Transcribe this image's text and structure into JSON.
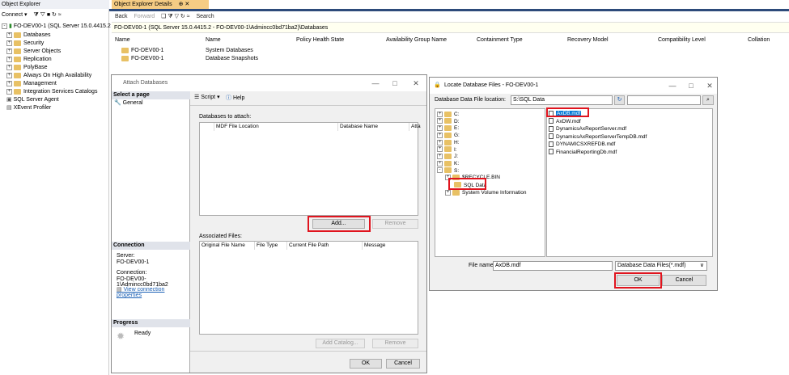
{
  "object_explorer": {
    "title": "Object Explorer",
    "connect_label": "Connect ▾",
    "server": "FO-DEV00-1 (SQL Server 15.0.4415.2 - F",
    "items": [
      "Databases",
      "Security",
      "Server Objects",
      "Replication",
      "PolyBase",
      "Always On High Availability",
      "Management",
      "Integration Services Catalogs",
      "SQL Server Agent",
      "XEvent Profiler"
    ]
  },
  "details": {
    "tab_label": "Object Explorer Details",
    "back": "Back",
    "forward": "Forward",
    "search": "Search",
    "path": "FO-DEV00-1 (SQL Server 15.0.4415.2 - FO-DEV00-1\\Admincc0bd71ba2)\\Databases",
    "columns": [
      "Name",
      "Name",
      "Policy Health State",
      "Availability Group Name",
      "Containment Type",
      "Recovery Model",
      "Compatibility Level",
      "Collation"
    ],
    "rows": [
      {
        "server": "FO-DEV00-1",
        "name": "System Databases"
      },
      {
        "server": "FO-DEV00-1",
        "name": "Database Snapshots"
      }
    ]
  },
  "attach": {
    "title": "Attach Databases",
    "select_page": "Select a page",
    "general": "General",
    "script": "Script",
    "help": "Help",
    "databases_label": "Databases to attach:",
    "db_columns": [
      "MDF File Location",
      "Database Name",
      "Atta"
    ],
    "add": "Add...",
    "remove": "Remove",
    "assoc_label": "Associated Files:",
    "assoc_columns": [
      "Original File Name",
      "File Type",
      "Current File Path",
      "Message"
    ],
    "add_catalog": "Add Catalog...",
    "remove2": "Remove",
    "ok": "OK",
    "cancel": "Cancel",
    "connection_h": "Connection",
    "server_label": "Server:",
    "server_value": "FO-DEV00-1",
    "connection_label": "Connection:",
    "connection_value": "FO-DEV00-1\\Admincc0bd71ba2",
    "view_props": "View connection properties",
    "progress_h": "Progress",
    "ready": "Ready"
  },
  "locate": {
    "title": "Locate Database Files - FO-DEV00-1",
    "location_label": "Database Data File location:",
    "location_value": "S:\\SQL Data",
    "drives": [
      "C:",
      "D:",
      "E:",
      "G:",
      "H:",
      "I:",
      "J:",
      "K:",
      "S:"
    ],
    "s_children": [
      "$RECYCLE.BIN",
      "SQL Data",
      "System Volume Information"
    ],
    "files": [
      "AxDB.mdf",
      "AxDW.mdf",
      "DynamicsAxReportServer.mdf",
      "DynamicsAxReportServerTempDB.mdf",
      "DYNAMICSXREFDB.mdf",
      "FinancialReportingDb.mdf"
    ],
    "file_name_label": "File name:",
    "file_name_value": "AxDB.mdf",
    "file_type": "Database Data Files(*.mdf)",
    "ok": "OK",
    "cancel": "Cancel"
  },
  "colors": {
    "tab": "#f5cc84",
    "accent": "#2d4a7a",
    "highlight": "#e0141e",
    "selected": "#0078d7"
  }
}
